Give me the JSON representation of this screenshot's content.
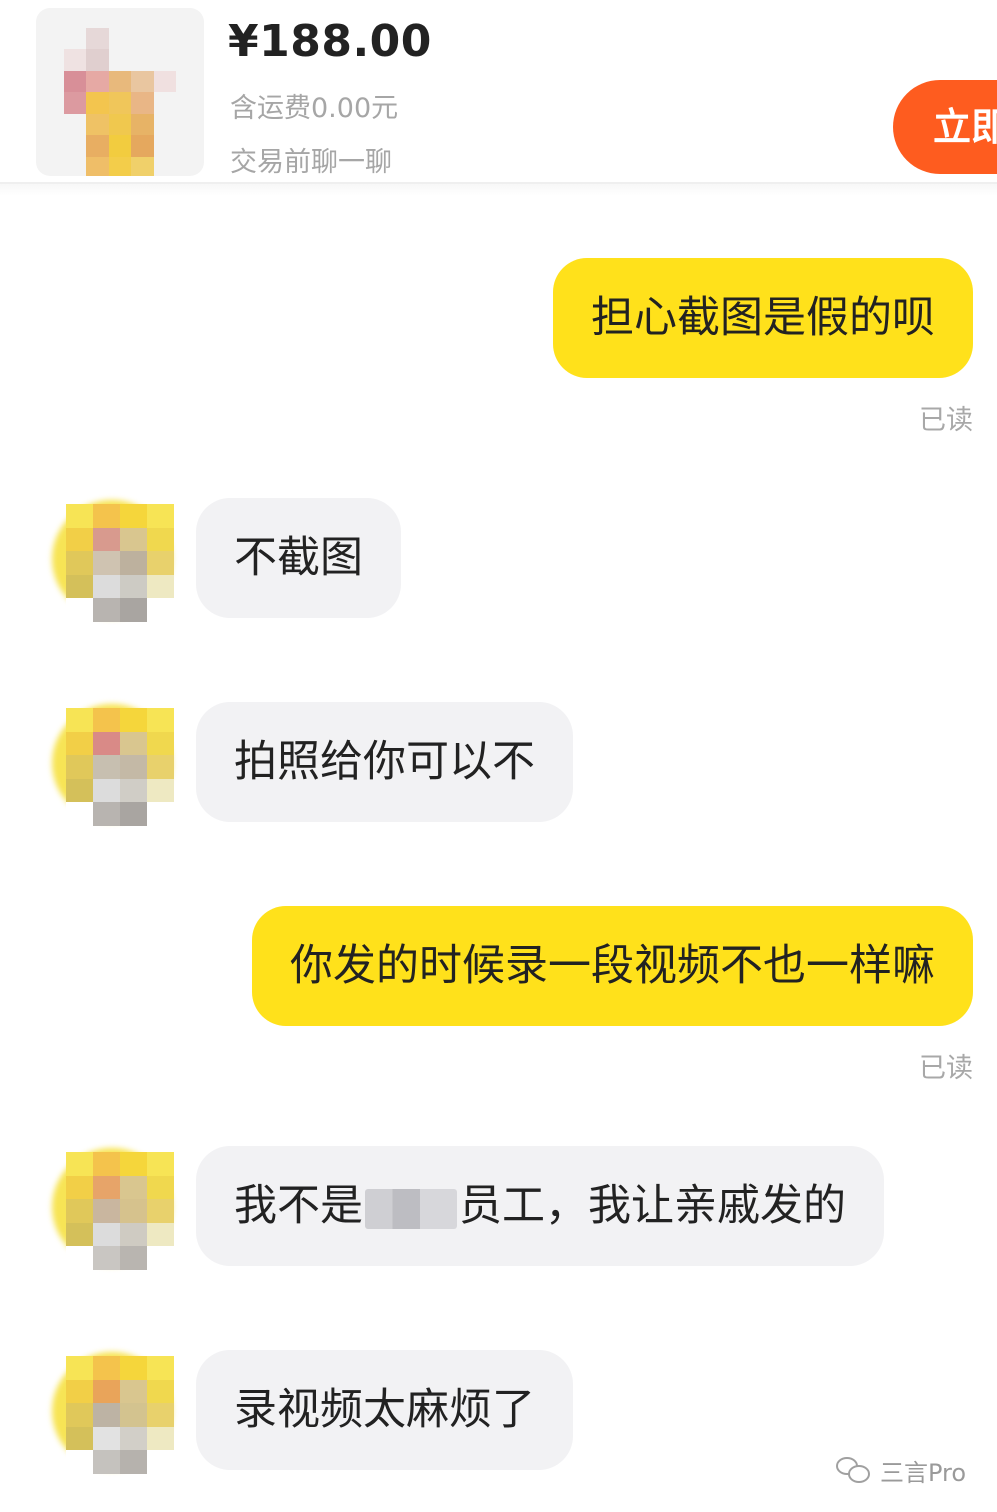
{
  "product": {
    "price": "¥188.00",
    "shipping": "含运费0.00元",
    "pre_chat_label": "交易前聊一聊",
    "buy_button_label": "立即"
  },
  "messages": [
    {
      "side": "out",
      "text": "担心截图是假的呗",
      "status": "已读"
    },
    {
      "side": "in",
      "text": "不截图"
    },
    {
      "side": "in",
      "text": "拍照给你可以不"
    },
    {
      "side": "out",
      "text": "你发的时候录一段视频不也一样嘛",
      "status": "已读"
    },
    {
      "side": "in",
      "text_before": "我不是",
      "text_after": "员工，我让亲戚发的"
    },
    {
      "side": "in",
      "text": "录视频太麻烦了"
    }
  ],
  "watermark": {
    "text": "三言Pro",
    "icon": "wechat-icon"
  },
  "colors": {
    "outgoing_bubble": "#ffe11b",
    "incoming_bubble": "#f2f2f4",
    "buy_button": "#fe5c1f"
  }
}
